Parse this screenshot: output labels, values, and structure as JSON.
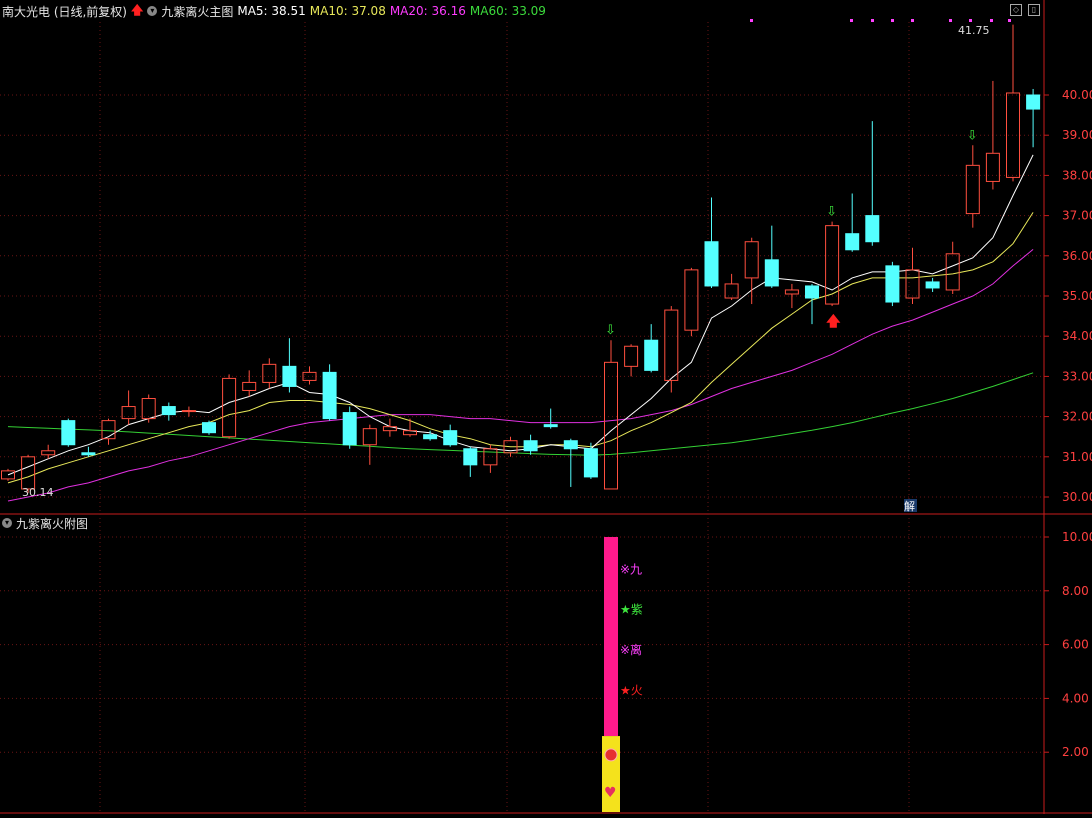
{
  "header": {
    "title": "南大光电 (日线,前复权)",
    "indicator": "九紫离火主图",
    "ma5": "MA5: 38.51",
    "ma10": "MA10: 37.08",
    "ma20": "MA20: 36.16",
    "ma60": "MA60: 33.09"
  },
  "sub_header": {
    "title": "九紫离火附图"
  },
  "annotations": {
    "low_label": "30.14",
    "high_label": "41.75",
    "jie": "解"
  },
  "sub_labels": [
    "※九",
    "★紫",
    "※离",
    "★火"
  ],
  "colors": {
    "up": "#ff4f3f",
    "down": "#54ffff",
    "ma5": "#ffffff",
    "ma10": "#e8e85a",
    "ma20": "#e030e0",
    "ma60": "#34d034",
    "axis": "#c81c1c",
    "bar": "#ff1a8c",
    "bar_base": "#f4e21c"
  },
  "chart_data": [
    {
      "type": "candlestick",
      "y_ticks": [
        "30.00",
        "31.00",
        "32.00",
        "33.00",
        "34.00",
        "35.00",
        "36.00",
        "37.00",
        "38.00",
        "39.00",
        "40.00"
      ],
      "ylim": [
        29.6,
        41.9
      ],
      "candles": [
        [
          30.45,
          30.65,
          30.4,
          30.7
        ],
        [
          30.2,
          31.0,
          30.1,
          31.05
        ],
        [
          31.05,
          31.15,
          30.95,
          31.3
        ],
        [
          31.9,
          31.3,
          31.25,
          31.95
        ],
        [
          31.1,
          31.05,
          31.0,
          31.25
        ],
        [
          31.45,
          31.9,
          31.3,
          31.95
        ],
        [
          31.95,
          32.25,
          31.8,
          32.65
        ],
        [
          31.95,
          32.45,
          31.85,
          32.55
        ],
        [
          32.25,
          32.05,
          31.9,
          32.35
        ],
        [
          32.15,
          32.15,
          32.0,
          32.25
        ],
        [
          31.85,
          31.6,
          31.55,
          31.9
        ],
        [
          31.5,
          32.95,
          31.45,
          33.05
        ],
        [
          32.65,
          32.85,
          32.5,
          33.15
        ],
        [
          32.85,
          33.3,
          32.7,
          33.45
        ],
        [
          33.25,
          32.75,
          32.6,
          33.95
        ],
        [
          32.9,
          33.1,
          32.8,
          33.25
        ],
        [
          33.1,
          31.95,
          31.9,
          33.3
        ],
        [
          32.1,
          31.3,
          31.2,
          32.25
        ],
        [
          31.3,
          31.7,
          30.8,
          31.8
        ],
        [
          31.65,
          31.75,
          31.5,
          31.95
        ],
        [
          31.55,
          31.65,
          31.5,
          31.95
        ],
        [
          31.55,
          31.45,
          31.4,
          31.65
        ],
        [
          31.65,
          31.3,
          31.25,
          31.8
        ],
        [
          31.2,
          30.8,
          30.5,
          31.25
        ],
        [
          30.8,
          31.2,
          30.6,
          31.3
        ],
        [
          31.1,
          31.4,
          31.0,
          31.5
        ],
        [
          31.4,
          31.15,
          31.05,
          31.55
        ],
        [
          31.8,
          31.75,
          31.7,
          32.2
        ],
        [
          31.4,
          31.2,
          30.25,
          31.45
        ],
        [
          31.2,
          30.5,
          30.45,
          31.35
        ],
        [
          30.2,
          33.35,
          30.2,
          33.9
        ],
        [
          33.25,
          33.75,
          33.0,
          33.8
        ],
        [
          33.9,
          33.15,
          33.1,
          34.3
        ],
        [
          32.9,
          34.65,
          32.6,
          34.75
        ],
        [
          34.15,
          35.65,
          34.0,
          35.7
        ],
        [
          36.35,
          35.25,
          35.2,
          37.45
        ],
        [
          34.95,
          35.3,
          34.9,
          35.55
        ],
        [
          35.45,
          36.35,
          34.8,
          36.45
        ],
        [
          35.9,
          35.25,
          35.2,
          36.75
        ],
        [
          35.05,
          35.15,
          34.7,
          35.3
        ],
        [
          35.25,
          34.95,
          34.3,
          35.3
        ],
        [
          34.8,
          36.75,
          34.75,
          36.85
        ],
        [
          36.55,
          36.15,
          36.1,
          37.55
        ],
        [
          37.0,
          36.35,
          36.25,
          39.35
        ],
        [
          35.75,
          34.85,
          34.75,
          35.85
        ],
        [
          34.95,
          35.65,
          34.8,
          36.2
        ],
        [
          35.35,
          35.2,
          35.1,
          35.45
        ],
        [
          35.15,
          36.05,
          35.05,
          36.35
        ],
        [
          37.05,
          38.25,
          36.7,
          38.75
        ],
        [
          37.85,
          38.55,
          37.65,
          40.35
        ],
        [
          37.95,
          40.05,
          37.85,
          41.75
        ],
        [
          40.0,
          39.65,
          38.7,
          40.15
        ]
      ],
      "ma5": [
        30.55,
        30.75,
        30.95,
        31.15,
        31.3,
        31.5,
        31.8,
        31.95,
        32.1,
        32.15,
        32.1,
        32.35,
        32.5,
        32.7,
        32.85,
        32.6,
        32.55,
        32.35,
        32.0,
        31.75,
        31.65,
        31.6,
        31.4,
        31.25,
        31.2,
        31.15,
        31.2,
        31.3,
        31.25,
        31.2,
        31.65,
        32.05,
        32.45,
        32.95,
        33.35,
        34.45,
        34.75,
        35.15,
        35.45,
        35.4,
        35.35,
        35.15,
        35.45,
        35.6,
        35.6,
        35.65,
        35.55,
        35.75,
        35.95,
        36.45,
        37.5,
        38.51
      ],
      "ma10": [
        30.35,
        30.5,
        30.7,
        30.85,
        31.0,
        31.15,
        31.3,
        31.45,
        31.6,
        31.75,
        31.85,
        32.05,
        32.15,
        32.35,
        32.4,
        32.4,
        32.35,
        32.3,
        32.2,
        32.05,
        31.9,
        31.7,
        31.55,
        31.45,
        31.3,
        31.25,
        31.25,
        31.3,
        31.3,
        31.25,
        31.4,
        31.65,
        31.85,
        32.1,
        32.35,
        32.85,
        33.3,
        33.75,
        34.2,
        34.55,
        34.9,
        35.05,
        35.3,
        35.45,
        35.45,
        35.45,
        35.5,
        35.55,
        35.65,
        35.85,
        36.3,
        37.08
      ],
      "ma20": [
        29.9,
        30.0,
        30.1,
        30.25,
        30.35,
        30.5,
        30.65,
        30.75,
        30.9,
        31.0,
        31.15,
        31.3,
        31.45,
        31.6,
        31.75,
        31.85,
        31.9,
        31.95,
        32.0,
        32.05,
        32.05,
        32.05,
        32.0,
        31.95,
        31.95,
        31.9,
        31.85,
        31.85,
        31.85,
        31.85,
        31.9,
        31.95,
        32.05,
        32.15,
        32.3,
        32.5,
        32.7,
        32.85,
        33.0,
        33.15,
        33.35,
        33.55,
        33.8,
        34.05,
        34.25,
        34.4,
        34.6,
        34.8,
        35.0,
        35.3,
        35.75,
        36.16
      ],
      "ma60": [
        31.75,
        31.73,
        31.71,
        31.69,
        31.67,
        31.65,
        31.62,
        31.59,
        31.56,
        31.53,
        31.5,
        31.47,
        31.44,
        31.41,
        31.38,
        31.35,
        31.32,
        31.29,
        31.26,
        31.23,
        31.2,
        31.18,
        31.16,
        31.14,
        31.12,
        31.1,
        31.08,
        31.06,
        31.05,
        31.04,
        31.06,
        31.1,
        31.15,
        31.2,
        31.25,
        31.3,
        31.35,
        31.42,
        31.5,
        31.58,
        31.66,
        31.75,
        31.85,
        31.97,
        32.09,
        32.2,
        32.32,
        32.45,
        32.6,
        32.75,
        32.92,
        33.09
      ],
      "down_arrows_at": [
        30,
        41,
        48
      ],
      "up_arrow_at": 41
    },
    {
      "type": "bar",
      "y_ticks": [
        "2.00",
        "4.00",
        "6.00",
        "8.00",
        "10.00"
      ],
      "ylim": [
        0,
        10.6
      ],
      "bar_index": 30,
      "bar_value": 10,
      "base_value": 2.6
    }
  ]
}
